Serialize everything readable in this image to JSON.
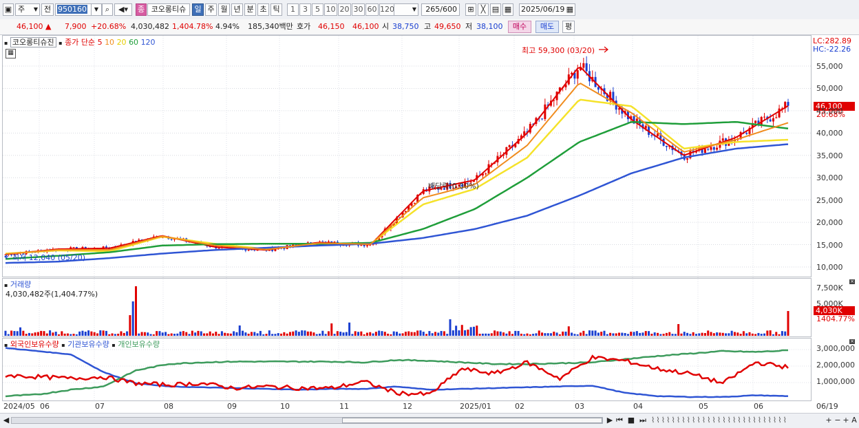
{
  "toolbar": {
    "stock_type": "주",
    "prev_btn": "전",
    "code": "950160",
    "name_badge": "종",
    "stock_name": "코오롱티슈",
    "periods": [
      "일",
      "주",
      "월",
      "년",
      "분",
      "초",
      "틱"
    ],
    "active_period": "일",
    "intervals": [
      "1",
      "3",
      "5",
      "10",
      "20",
      "30",
      "60",
      "120"
    ],
    "count": "265",
    "count_total": "/600",
    "date": "2025/06/19"
  },
  "status": {
    "price": "46,100",
    "change": "7,900",
    "change_pct": "+20.68%",
    "volume": "4,030,482",
    "volume_pct": "1,404.78%",
    "turnover_pct": "4.94%",
    "amount": "185,340백만",
    "ask_label": "호가",
    "ask": "46,150",
    "bid": "46,100",
    "open_label": "시",
    "open": "38,750",
    "high_label": "고",
    "high": "49,650",
    "low_label": "저",
    "low": "38,100",
    "buy_label": "매수",
    "sell_label": "매도",
    "eval_label": "평"
  },
  "price_pane": {
    "stock_label": "코오롱티슈진",
    "ma_label": "종가 단순",
    "ma_periods": [
      "5",
      "10",
      "20",
      "60",
      "120"
    ],
    "lc": "LC:282.89",
    "hc": "HC:-22.26",
    "high_annotation": "최고 59,300 (03/20)",
    "low_annotation": "최저 12,040 (05/20)",
    "dividend_annotation": "배당락(0.00%)",
    "current_price_tag": "46,100",
    "current_pct_tag": "20.68%",
    "y_labels": [
      "55,000",
      "50,000",
      "45,000",
      "40,000",
      "35,000",
      "30,000",
      "25,000",
      "20,000",
      "15,000",
      "10,000"
    ]
  },
  "volume_pane": {
    "title": "거래량",
    "value": "4,030,482주(1,404.77%)",
    "y_labels": [
      "7,500K",
      "5,000K"
    ],
    "tag": "4,030K",
    "tag_pct": "1404.77%"
  },
  "holdings_pane": {
    "legend": [
      "외국인보유수량",
      "기관보유수량",
      "개인보유수량"
    ],
    "y_labels": [
      "3,000,000",
      "2,000,000",
      "1,000,000"
    ]
  },
  "x_axis": [
    "2024/05",
    "06",
    "07",
    "08",
    "09",
    "10",
    "11",
    "12",
    "2025/01",
    "02",
    "03",
    "04",
    "05",
    "06",
    "06/19"
  ],
  "colors": {
    "up": "#e00000",
    "down": "#1a3fd0",
    "ma5": "#e00000",
    "ma10": "#f08c1e",
    "ma20": "#f5e22a",
    "ma60": "#1f9e3a",
    "ma120": "#2f55d4",
    "foreign": "#e00000",
    "institution": "#2f55d4",
    "individual": "#3d9b5c"
  },
  "chart_data": {
    "type": "line",
    "title": "",
    "x": [
      "2024/05",
      "06",
      "07",
      "08",
      "09",
      "10",
      "11",
      "12",
      "2025/01",
      "02",
      "03",
      "04",
      "05",
      "06",
      "06/19"
    ],
    "series": [
      {
        "name": "종가 단순 5",
        "values": [
          12800,
          14000,
          14200,
          17000,
          14500,
          13800,
          15500,
          15000,
          27000,
          29500,
          40000,
          55000,
          43000,
          35000,
          39000,
          46100
        ]
      },
      {
        "name": "종가 단순 20",
        "values": [
          13000,
          13700,
          13500,
          16800,
          15200,
          14000,
          15200,
          15200,
          24000,
          27500,
          34500,
          47500,
          46000,
          36500,
          38000,
          38500
        ]
      },
      {
        "name": "종가 단순 60",
        "values": [
          11800,
          12500,
          13300,
          14800,
          15100,
          15200,
          15200,
          15400,
          18500,
          23000,
          30000,
          38000,
          42500,
          42000,
          42500,
          41000
        ]
      },
      {
        "name": "종가 단순 120",
        "values": [
          10900,
          11200,
          12000,
          13000,
          13800,
          14300,
          14800,
          15200,
          16500,
          18500,
          21500,
          26000,
          31000,
          34500,
          36500,
          37500
        ]
      }
    ],
    "price_high": 59300,
    "price_low": 12040,
    "ylim": [
      8000,
      60000
    ]
  }
}
